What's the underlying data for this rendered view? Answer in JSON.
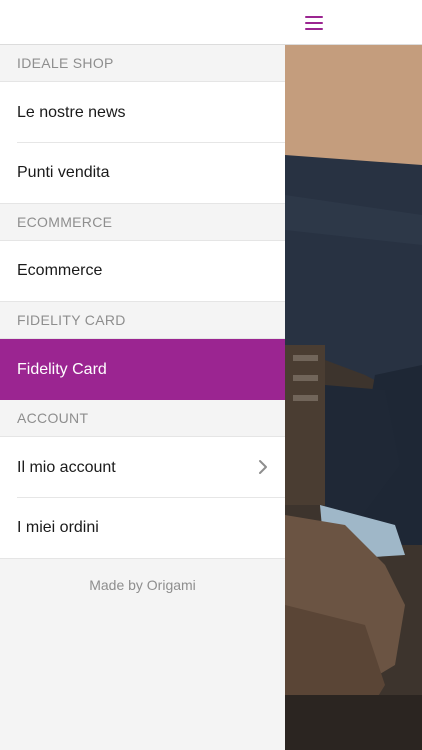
{
  "header": {
    "menu_icon": "hamburger-icon",
    "accent_color": "#9b2591"
  },
  "drawer": {
    "sections": [
      {
        "title": "IDEALE SHOP",
        "items": [
          {
            "label": "Le nostre news"
          },
          {
            "label": "Punti vendita"
          }
        ]
      },
      {
        "title": "ECOMMERCE",
        "items": [
          {
            "label": "Ecommerce"
          }
        ]
      },
      {
        "title": "FIDELITY CARD",
        "items": [
          {
            "label": "Fidelity Card",
            "active": true
          }
        ]
      },
      {
        "title": "ACCOUNT",
        "items": [
          {
            "label": "Il mio account",
            "icon": "chevron-right-icon"
          },
          {
            "label": "I miei ordini"
          }
        ]
      }
    ],
    "footer": "Made by Origami"
  }
}
